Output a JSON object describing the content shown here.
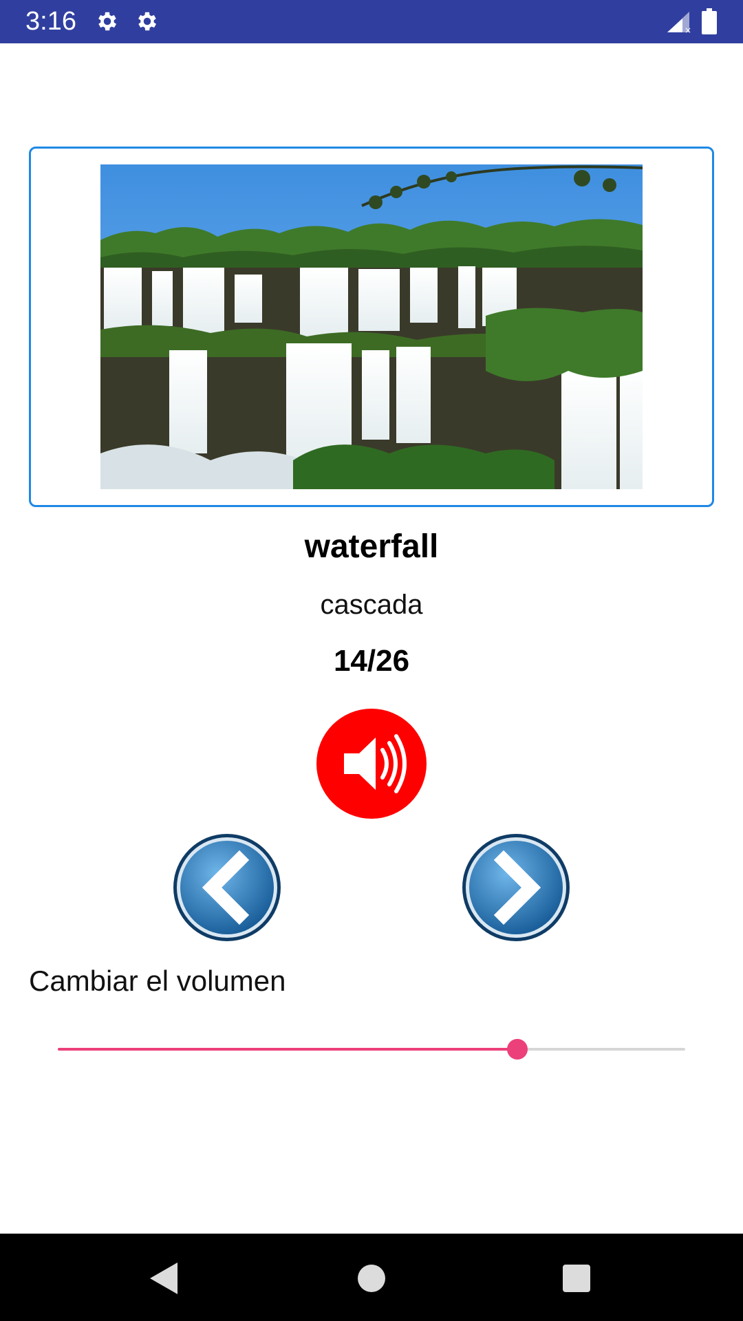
{
  "status_bar": {
    "time": "3:16",
    "icons": [
      "gear-icon",
      "gear-icon",
      "signal-icon",
      "battery-icon"
    ],
    "background_color": "#303f9f"
  },
  "card": {
    "image_description_icon": "waterfall-photo",
    "border_color": "#1e88e5"
  },
  "word": "waterfall",
  "translation": "cascada",
  "counter": "14/26",
  "sound_button": {
    "icon": "speaker-icon",
    "color": "#ff0000"
  },
  "navigation": {
    "previous_icon": "chevron-left-icon",
    "next_icon": "chevron-right-icon",
    "color": "#1f6fb0"
  },
  "volume": {
    "label": "Cambiar el volumen",
    "value": 0.733,
    "accent_color": "#ec407a"
  },
  "system_nav": [
    "back-icon",
    "home-icon",
    "recents-icon"
  ]
}
